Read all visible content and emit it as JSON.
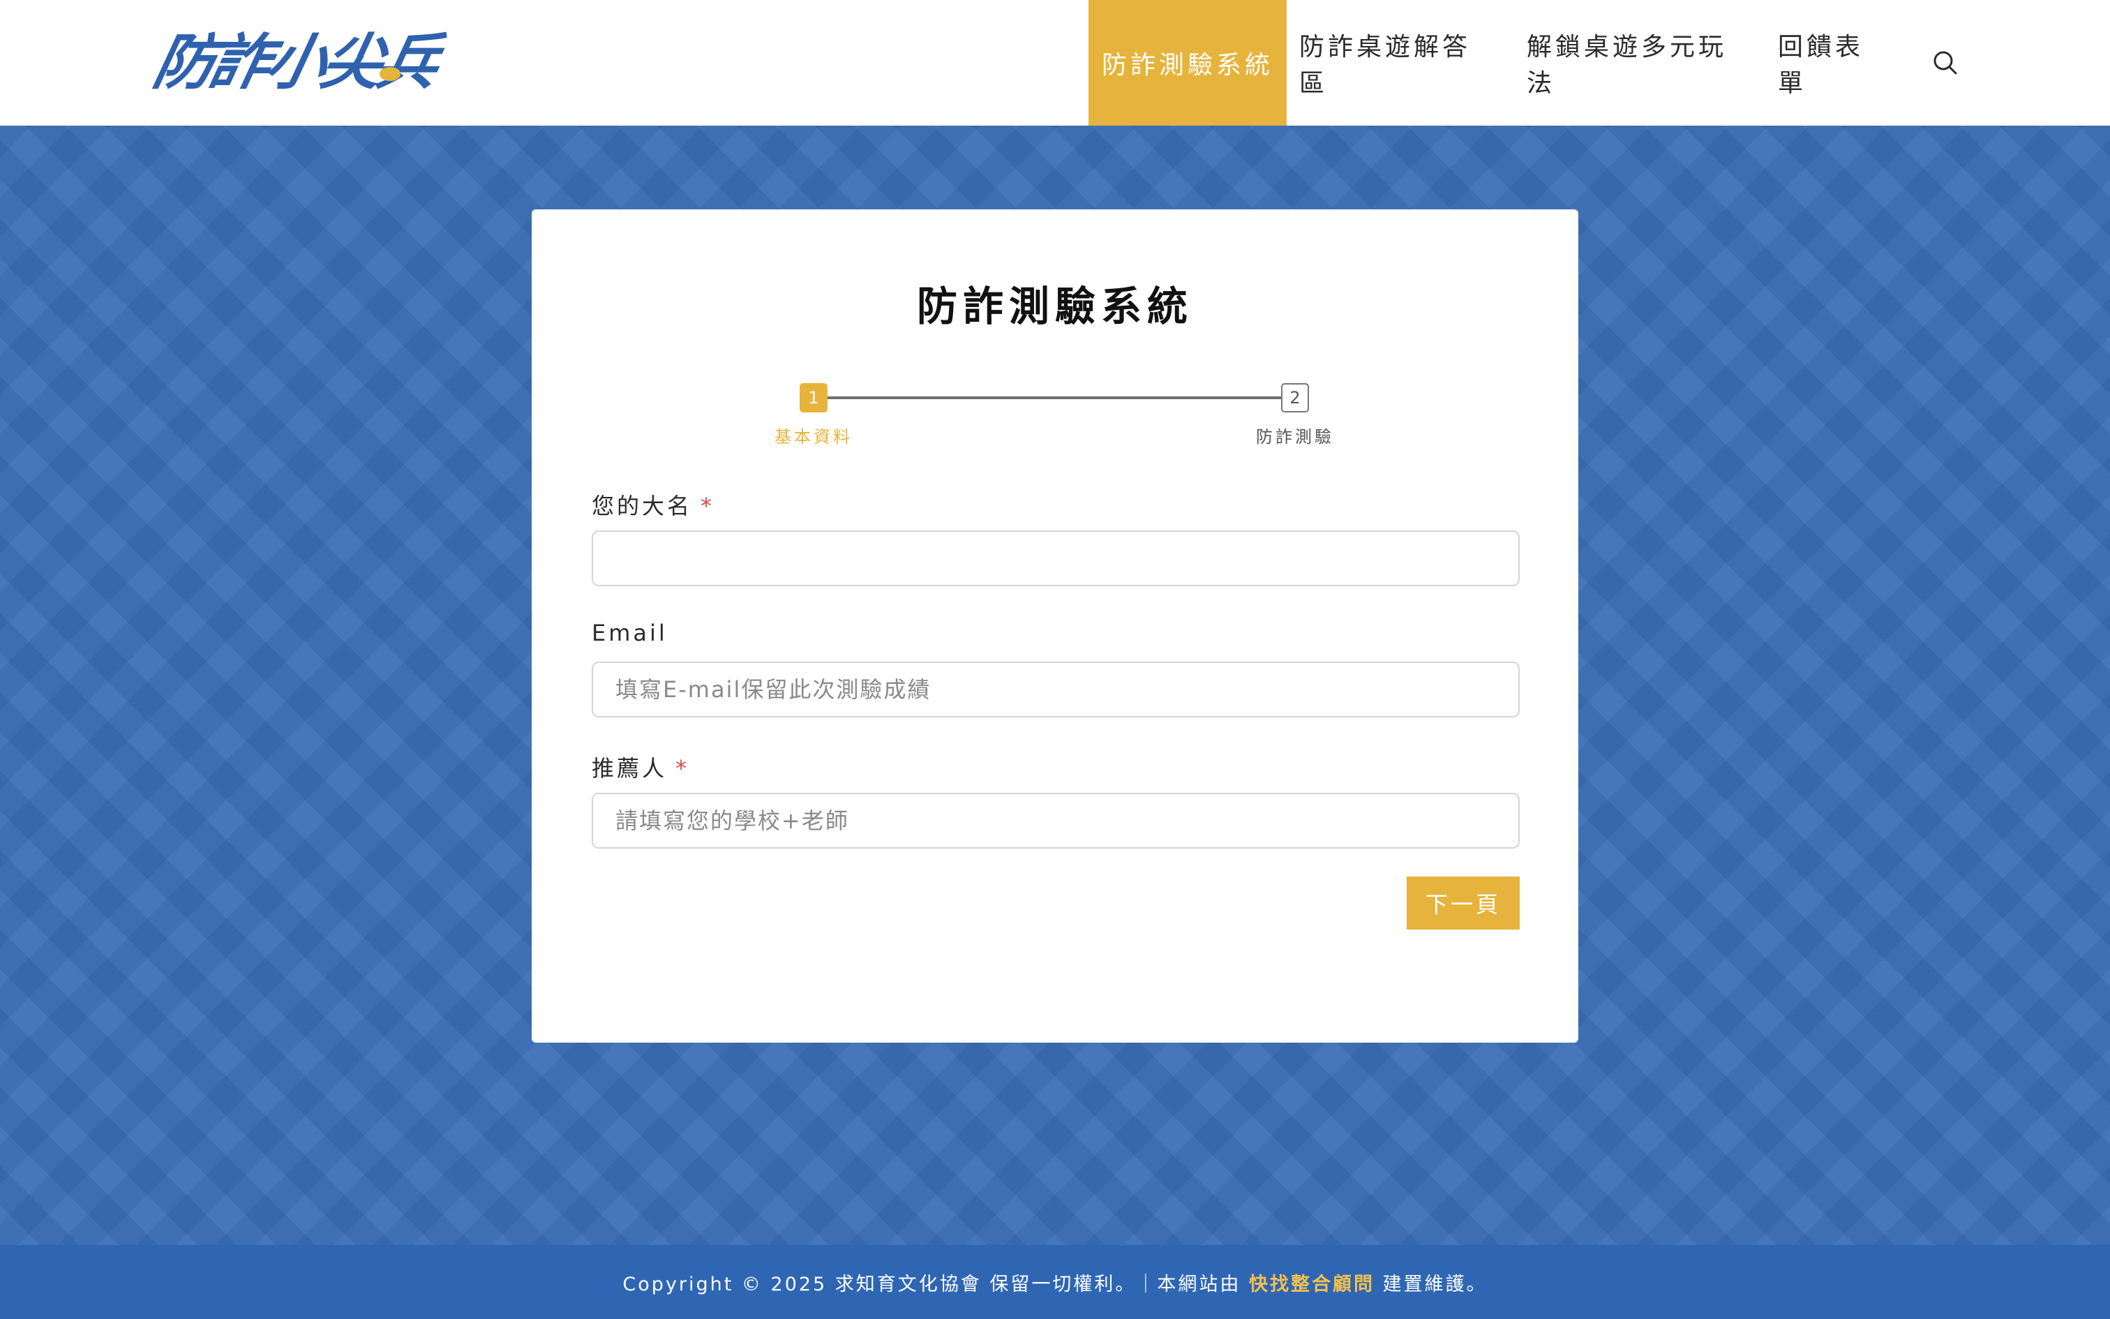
{
  "brand": {
    "logo_text": "防詐小尖兵",
    "primary_color": "#2f62ae",
    "accent_color": "#e6b43c"
  },
  "nav": {
    "items": [
      {
        "label": "防詐測驗系統",
        "active": true
      },
      {
        "label": "防詐桌遊解答區",
        "active": false
      },
      {
        "label": "解鎖桌遊多元玩法",
        "active": false
      },
      {
        "label": "回饋表單",
        "active": false
      }
    ],
    "search_icon": "search-icon"
  },
  "form": {
    "title": "防詐測驗系統",
    "steps": [
      {
        "number": "1",
        "label": "基本資料",
        "active": true
      },
      {
        "number": "2",
        "label": "防詐測驗",
        "active": false
      }
    ],
    "fields": {
      "name": {
        "label": "您的大名",
        "required_mark": "*",
        "value": "",
        "placeholder": ""
      },
      "email": {
        "label": "Email",
        "value": "",
        "placeholder": "填寫E-mail保留此次測驗成績"
      },
      "referrer": {
        "label": "推薦人",
        "required_mark": "*",
        "value": "",
        "placeholder": "請填寫您的學校+老師"
      }
    },
    "next_label": "下一頁"
  },
  "footer": {
    "text_before": "Copyright © 2025 求知育文化協會 保留一切權利。｜本網站由 ",
    "link_text": "快找整合顧問",
    "text_after": " 建置維護。"
  }
}
